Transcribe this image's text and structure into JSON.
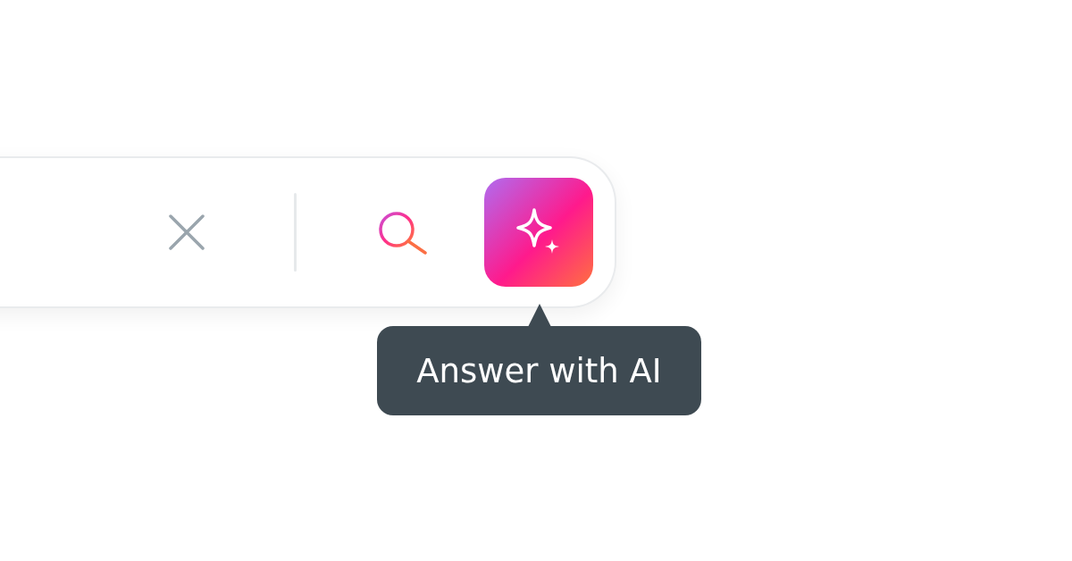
{
  "tooltip": {
    "text": "Answer with AI"
  }
}
